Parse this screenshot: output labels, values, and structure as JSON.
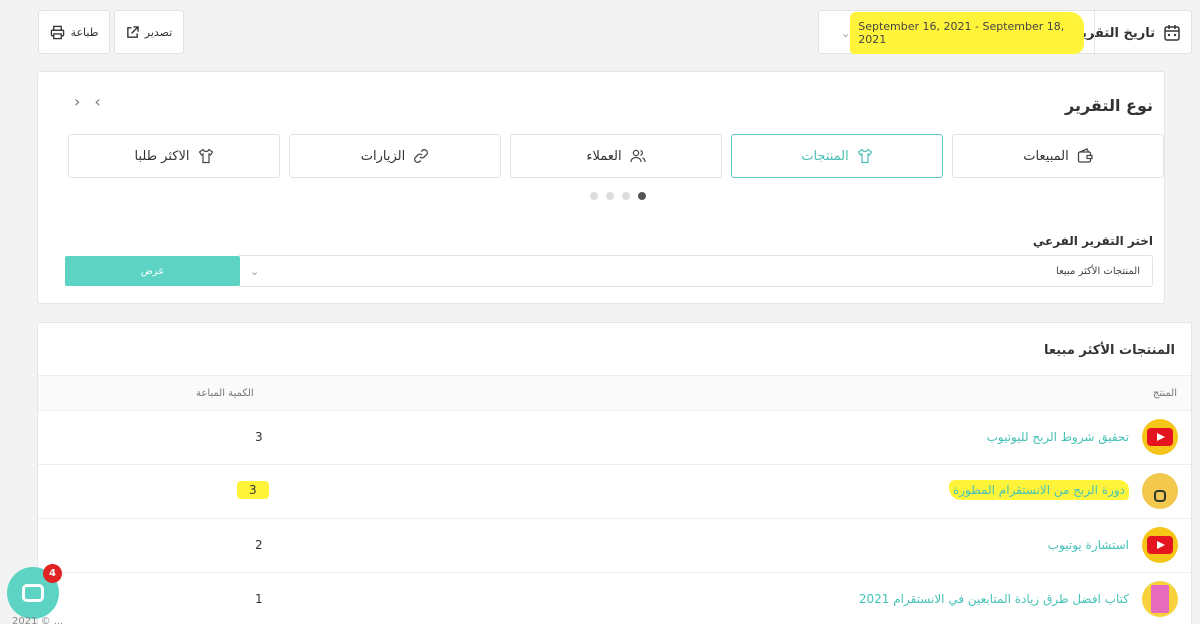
{
  "toolbar": {
    "report_date_label": "تاريخ التقرير",
    "date_range": "September 16, 2021 - September 18, 2021",
    "export_label": "تصدير",
    "print_label": "طباعة"
  },
  "report_type": {
    "title": "نوع التقرير",
    "tabs": [
      {
        "label": "المبيعات",
        "icon": "wallet-icon",
        "active": false
      },
      {
        "label": "المنتجات",
        "icon": "shirt-icon",
        "active": true
      },
      {
        "label": "العملاء",
        "icon": "users-icon",
        "active": false
      },
      {
        "label": "الزيارات",
        "icon": "link-icon",
        "active": false
      },
      {
        "label": "الاكثر طلبا",
        "icon": "shirt-icon",
        "active": false
      }
    ],
    "sub_report_label": "اختر التقرير الفرعي",
    "sub_report_value": "المنتجات الأكثر مبيعا",
    "show_button": "عرض"
  },
  "table": {
    "title": "المنتجات الأكثر مبيعا",
    "columns": {
      "product": "المنتج",
      "qty": "الكمية المباعة"
    },
    "rows": [
      {
        "name": "تحقيق شروط الربح لليوتيوب",
        "qty": "3",
        "thumb": "youtube-thumbnail"
      },
      {
        "name": "دورة الربح من الانستقرام المطورة",
        "qty": "3",
        "thumb": "instagram-thumbnail"
      },
      {
        "name": "استشارة يوتيوب",
        "qty": "2",
        "thumb": "youtube-thumbnail"
      },
      {
        "name": "كتاب افضل طرق زيادة المتابعين في الانستقرام 2021",
        "qty": "1",
        "thumb": "book-thumbnail"
      }
    ]
  },
  "chat": {
    "badge": "4"
  },
  "footer": {
    "text": "2021 © ..."
  },
  "colors": {
    "accent": "#5dd3c3",
    "highlight": "#fff43a",
    "badge": "#e02424"
  }
}
